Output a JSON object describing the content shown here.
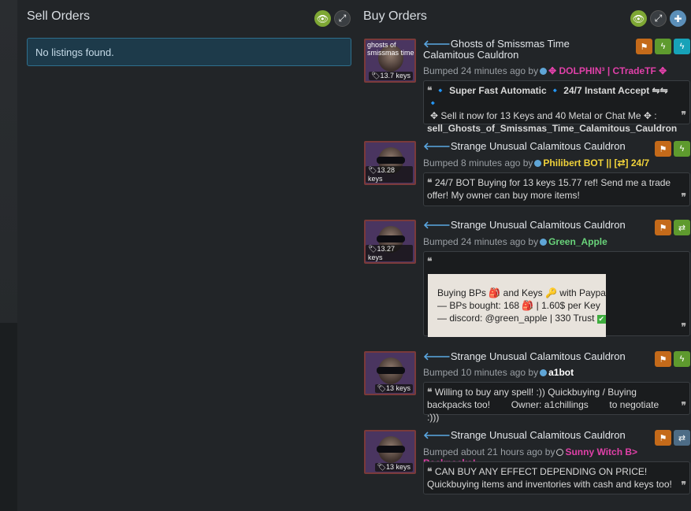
{
  "sell": {
    "title": "Sell Orders",
    "empty_text": "No listings found."
  },
  "buy": {
    "title": "Buy Orders",
    "items": [
      {
        "title": "Ghosts of Smissmas Time Calamitous Cauldron",
        "thumb_text": "ghosts of smissmas time",
        "price": "13.7 keys",
        "bumped": "Bumped 24 minutes ago by",
        "user": "✥ DOLPHIN³ | CTradeTF ✥",
        "user_color": "#e040a8",
        "desc_l1": "🔹 Super Fast Automatic 🔹 24/7 Instant Accept ⇋⇋ 🔹",
        "desc_l2": "✥ Sell it now for 13 Keys and 40 Metal or Chat Me ✥ :",
        "desc_l3": "sell_Ghosts_of_Smissmas_Time_Calamitous_Cauldron"
      },
      {
        "title": "Strange Unusual Calamitous Cauldron",
        "price": "13.28 keys",
        "bumped": "Bumped 8 minutes ago by",
        "user": "Philibert BOT || [⇄] 24/7",
        "user_color": "#f0d23a",
        "desc": "24/7 BOT Buying for 13 keys 15.77 ref! Send me a trade offer! My owner can buy more items!"
      },
      {
        "title": "Strange Unusual Calamitous Cauldron",
        "price": "13.27 keys",
        "bumped": "Bumped 24 minutes ago by",
        "user": "Green_Apple",
        "user_color": "#69d37a",
        "box": {
          "l1": "Buying BPs 🎒 and Keys 🔑 with Paypal",
          "l2": "— BPs bought: 168 🎒 | 1.60$ per Key",
          "l3": "— discord: @green_apple | 330 Trust"
        }
      },
      {
        "title": "Strange Unusual Calamitous Cauldron",
        "price": "13 keys",
        "bumped": "Bumped 10 minutes ago by",
        "user": "a1bot",
        "user_color": "#ffffff",
        "desc": "Willing to buy any spell! :)) Quickbuying / Buying backpacks too!        Owner: a1chillings        to negotiate :)))"
      },
      {
        "title": "Strange Unusual Calamitous Cauldron",
        "price": "13 keys",
        "bumped": "Bumped about 21 hours ago by",
        "user": "Sunny Witch B> Backpacks!",
        "user_color": "#e040a8",
        "desc": "CAN BUY ANY EFFECT DEPENDING ON PRICE! Quickbuying items and inventories with cash and keys too!"
      }
    ]
  },
  "icons": {
    "quote_open": "❝",
    "quote_close": "❞",
    "arrow": "⟵"
  }
}
